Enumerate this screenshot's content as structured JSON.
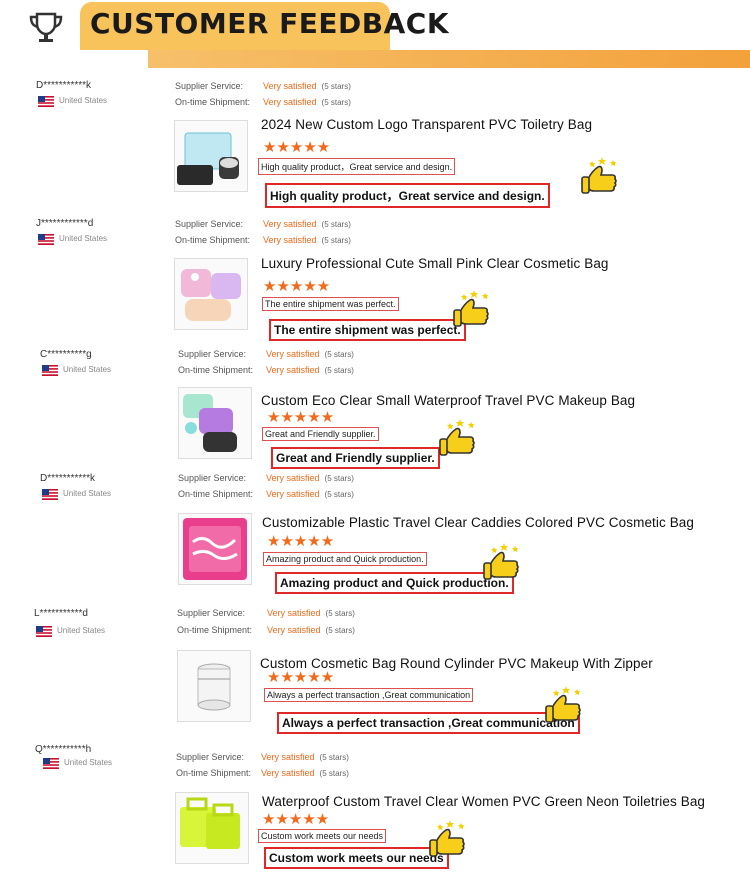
{
  "header": {
    "title": "CUSTOMER FEEDBACK"
  },
  "labels": {
    "supplier_service": "Supplier Service:",
    "ontime_shipment": "On-time Shipment:"
  },
  "colors": {
    "accent": "#f26a1b",
    "banner": "#f7c35a",
    "highlight_border": "#e02828"
  },
  "entries": [
    {
      "user": "D***********k",
      "country": "United States",
      "supplier_rating": "Very satisfied",
      "supplier_stars": "(5 stars)",
      "shipment_rating": "Very satisfied",
      "shipment_stars": "(5 stars)",
      "product_title": "2024 New Custom Logo Transparent PVC Toiletry Bag",
      "stars": "★★★★★",
      "review_small": "High quality product，Great service and design.",
      "review_big": "High quality product，Great service and design."
    },
    {
      "user": "J************d",
      "country": "United States",
      "supplier_rating": "Very satisfied",
      "supplier_stars": "(5 stars)",
      "shipment_rating": "Very satisfied",
      "shipment_stars": "(5 stars)",
      "product_title": "Luxury Professional Cute Small  Pink Clear Cosmetic Bag",
      "stars": "★★★★★",
      "review_small": "The entire shipment was perfect.",
      "review_big": "The entire shipment was perfect."
    },
    {
      "user": "C**********g",
      "country": "United States",
      "supplier_rating": "Very satisfied",
      "supplier_stars": "(5 stars)",
      "shipment_rating": "Very satisfied",
      "shipment_stars": "(5 stars)",
      "product_title": "Custom Eco Clear Small Waterproof Travel PVC Makeup Bag",
      "stars": "★★★★★",
      "review_small": "Great and Friendly supplier.",
      "review_big": "Great and Friendly supplier."
    },
    {
      "user": "D***********k",
      "country": "United States",
      "supplier_rating": "Very satisfied",
      "supplier_stars": "(5 stars)",
      "shipment_rating": "Very satisfied",
      "shipment_stars": "(5 stars)",
      "product_title": "Customizable Plastic Travel Clear Caddies Colored PVC Cosmetic Bag",
      "stars": "★★★★★",
      "review_small": "Amazing product and Quick production.",
      "review_big": "Amazing product and Quick production."
    },
    {
      "user": "L***********d",
      "country": "United States",
      "supplier_rating": "Very satisfied",
      "supplier_stars": "(5 stars)",
      "shipment_rating": "Very satisfied",
      "shipment_stars": "(5 stars)",
      "product_title": "Custom Cosmetic Bag Round Cylinder PVC Makeup  With Zipper",
      "stars": "★★★★★",
      "review_small": "Always a perfect transaction ,Great communication",
      "review_big": "Always a perfect transaction ,Great communication"
    },
    {
      "user": "Q***********h",
      "country": "United States",
      "supplier_rating": "Very satisfied",
      "supplier_stars": "(5 stars)",
      "shipment_rating": "Very satisfied",
      "shipment_stars": "(5 stars)",
      "product_title": "Waterproof Custom Travel Clear Women PVC Green Neon Toiletries Bag",
      "stars": "★★★★★",
      "review_small": "Custom work meets our needs",
      "review_big": "Custom work meets our needs"
    }
  ]
}
